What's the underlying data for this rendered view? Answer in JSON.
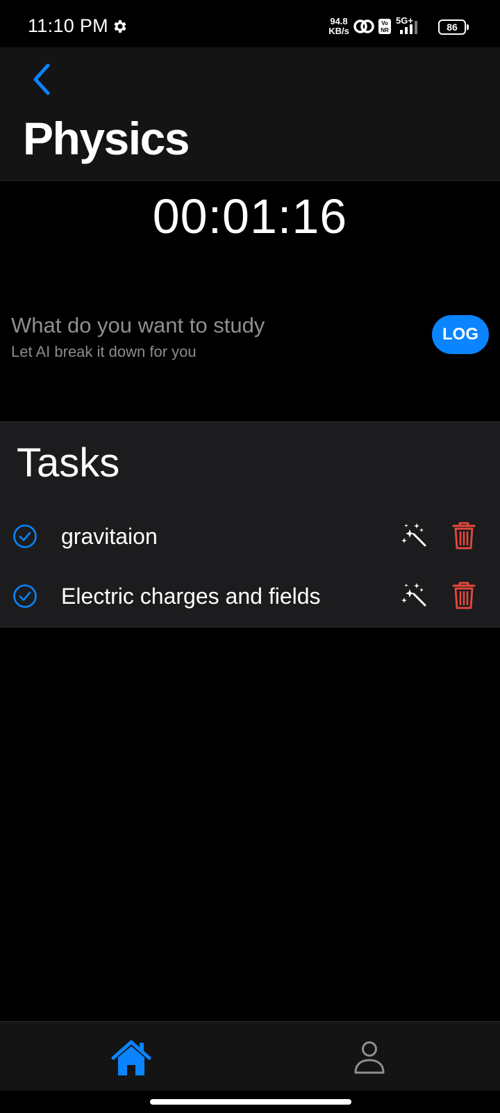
{
  "status_bar": {
    "time": "11:10 PM",
    "net_speed_value": "94.8",
    "net_speed_unit": "KB/s",
    "network_type": "5G+",
    "volte_label": "Vo NR",
    "battery_level": "86",
    "icons": [
      "gear-icon",
      "hotspot-icon",
      "volte-icon",
      "signal-icon",
      "battery-icon"
    ]
  },
  "header": {
    "back_icon": "chevron-left-icon",
    "title": "Physics"
  },
  "timer": {
    "value": "00:01:16"
  },
  "study_prompt": {
    "title": "What do you want to study",
    "subtitle": "Let AI break it down for you",
    "log_label": "LOG"
  },
  "tasks": {
    "heading": "Tasks",
    "items": [
      {
        "label": "gravitaion"
      },
      {
        "label": "Electric charges and fields"
      }
    ],
    "item_icons": [
      "check-circle-icon",
      "magic-wand-icon",
      "trash-icon"
    ]
  },
  "bottom_nav": {
    "items": [
      {
        "icon": "home-icon",
        "active": true
      },
      {
        "icon": "person-icon",
        "active": false
      }
    ]
  },
  "colors": {
    "accent": "#0a84ff",
    "danger": "#e5483c",
    "background": "#000000",
    "header_bg": "#141414",
    "panel_bg": "#1c1c1e",
    "muted_text": "#8f8f8f"
  }
}
